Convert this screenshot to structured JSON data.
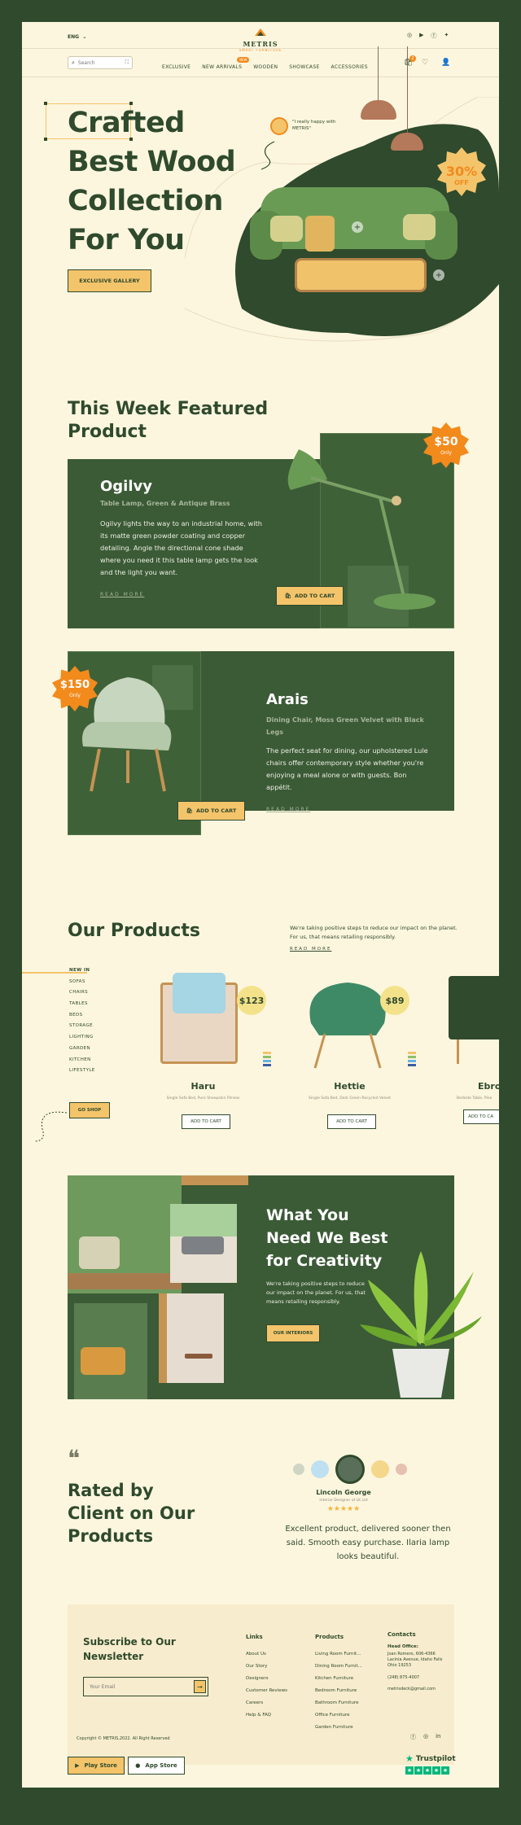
{
  "topbar": {
    "lang": "ENG",
    "brand": "METRIS",
    "tagline": "SMART FURNITURE"
  },
  "search": {
    "placeholder": "Search"
  },
  "nav": {
    "items": [
      "EXCLUSIVE",
      "NEW ARRIVALS",
      "WOODEN",
      "SHOWCASE",
      "ACCESSORIES"
    ],
    "badge": "NEW",
    "cart_count": "2"
  },
  "hero": {
    "title_line1": "Crafted",
    "title_line2": "Best Wood",
    "title_line3": "Collection",
    "title_line4": "For You",
    "cta": "EXCLUSIVE GALLERY",
    "quote": "\"I really happy with METRIS\"",
    "discount": "30%",
    "discount_label": "OFF"
  },
  "featured": {
    "heading_line1": "This Week Featured",
    "heading_line2": "Product",
    "p1": {
      "name": "Ogilvy",
      "subtitle": "Table Lamp, Green & Antique Brass",
      "desc": "Ogilvy lights the way to an industrial home, with its matte green powder coating and copper detailing. Angle the directional cone shade where you need it this table lamp gets the look and the light you want.",
      "read_more": "READ MORE",
      "cta": "ADD TO CART",
      "price": "$50",
      "price_label": "Only"
    },
    "p2": {
      "name": "Arais",
      "subtitle": "Dining Chair, Moss Green Velvet with Black Legs",
      "desc": "The perfect seat for dining, our upholstered Lule chairs offer contemporary style whether you're enjoying a meal alone or with guests. Bon appétit.",
      "read_more": "READ MORE",
      "cta": "ADD TO CART",
      "price": "$150",
      "price_label": "Only"
    }
  },
  "products": {
    "heading": "Our Products",
    "intro": "We're taking positive steps to reduce our impact on the planet. For us, that means retailing responsibly.",
    "read_more": "READ MORE",
    "categories": [
      "NEW IN",
      "SOFAS",
      "CHAIRS",
      "TABLES",
      "BEDS",
      "STORAGE",
      "LIGHTING",
      "GARDEN",
      "KITCHEN",
      "LIFESTYLE"
    ],
    "shop_cta": "GO SHOP",
    "items": [
      {
        "name": "Haru",
        "desc": "Single Sofa Bed, Pure Sheepskin Fitness",
        "price": "$123",
        "cta": "ADD TO CART"
      },
      {
        "name": "Hettie",
        "desc": "Single Sofa Bed, Dark Green Recycled Velvet",
        "price": "$89",
        "cta": "ADD TO CART"
      },
      {
        "name": "Ebro",
        "desc": "Bedside Table, Pine",
        "price": "",
        "cta": "ADD TO CA"
      }
    ]
  },
  "creativity": {
    "title_line1": "What You",
    "title_line2": "Need We Best",
    "title_line3": "for Creativity",
    "desc": "We're taking positive steps to reduce our impact on the planet. For us, that means retailing responsibly.",
    "cta": "OUR INTERIORS"
  },
  "testimonial": {
    "heading_line1": "Rated by",
    "heading_line2": "Client on Our",
    "heading_line3": "Products",
    "name": "Lincoln George",
    "role": "Interior Designer of LK Ltd",
    "stars": "★★★★★",
    "quote": "Excellent product, delivered sooner then said. Smooth easy purchase. Ilaria lamp looks beautiful."
  },
  "footer": {
    "subscribe_line1": "Subscribe to Our",
    "subscribe_line2": "Newsletter",
    "email_placeholder": "Your Email",
    "links_title": "Links",
    "links": [
      "About Us",
      "Our Story",
      "Designers",
      "Customer Reviews",
      "Careers",
      "Help & FAQ"
    ],
    "products_title": "Products",
    "products": [
      "Living Room Furnit...",
      "Dining Room Furnit...",
      "Kitchen Furniture",
      "Bedroom Furniture",
      "Bathroom Furniture",
      "Office Furniture",
      "Garden Furniture"
    ],
    "contacts_title": "Contacts",
    "head_office": "Head Office:",
    "address": "Joan Romero, 606-4366 Lacinia Avenue, Idaho Falls Ohio 19253",
    "phone": "(248) 875-4007",
    "email": "metrisdeck@gmail.com",
    "copyright": "Copyright © METRIS,2022. All Right Reserved",
    "play_store": "Play Store",
    "app_store": "App Store",
    "trustpilot": "Trustpilot"
  },
  "colors": {
    "primary": "#2f4a2c",
    "accent": "#f4c46b",
    "orange": "#f28a1c",
    "bg": "#fdf6df"
  }
}
